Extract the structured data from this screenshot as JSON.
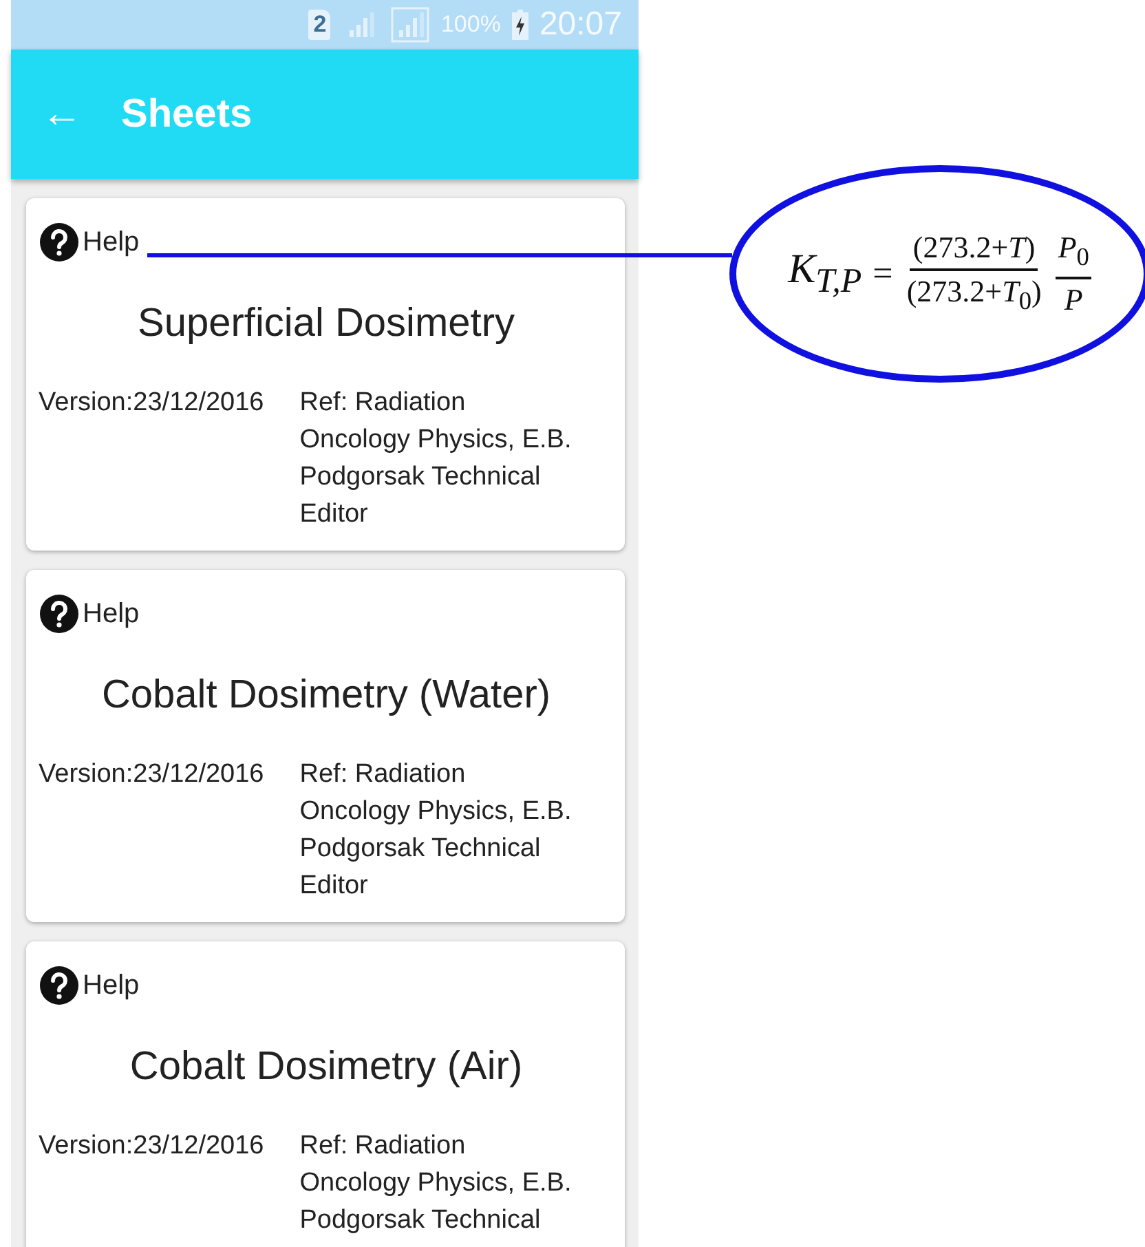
{
  "status_bar": {
    "sim_slot": "2",
    "battery": "100%",
    "time": "20:07"
  },
  "app_bar": {
    "back": "←",
    "title": "Sheets"
  },
  "cards": [
    {
      "help": "Help",
      "title": "Superficial Dosimetry",
      "version": "Version:23/12/2016",
      "ref": "Ref: Radiation Oncology Physics, E.B. Podgorsak Technical Editor",
      "annotated": true
    },
    {
      "help": "Help",
      "title": "Cobalt Dosimetry (Water)",
      "version": "Version:23/12/2016",
      "ref": "Ref: Radiation Oncology Physics, E.B. Podgorsak Technical Editor",
      "annotated": false
    },
    {
      "help": "Help",
      "title": "Cobalt Dosimetry (Air)",
      "version": "Version:23/12/2016",
      "ref": "Ref: Radiation Oncology Physics, E.B. Podgorsak Technical",
      "annotated": false
    }
  ],
  "callout": {
    "lhs": "K$_{T,P}$",
    "equals": "=",
    "numerator": "(273.2+*T*)",
    "denominator": "(273.2+*T*$_{0}$)",
    "numerator_2": "*P*$_{0}$",
    "denominator_2": "*P*"
  }
}
